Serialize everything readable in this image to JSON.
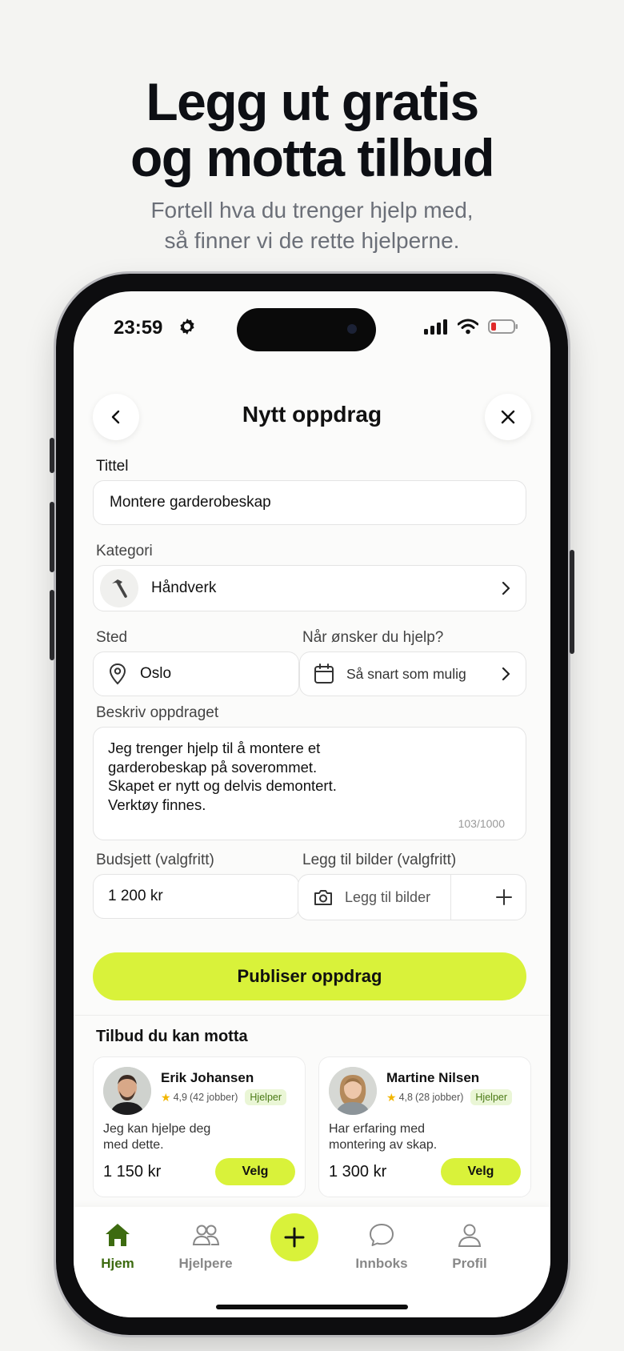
{
  "hero": {
    "title": "Legg ut gratis\nog motta tilbud",
    "subtitle": "Fortell hva du trenger hjelp med,\nså finner vi de rette hjelperne."
  },
  "status_bar": {
    "time": "23:59"
  },
  "header": {
    "title": "Nytt oppdrag",
    "back_icon": "chevron-left-icon",
    "close_icon": "close-icon"
  },
  "form": {
    "title_label": "Tittel",
    "title_value": "Montere garderobeskap",
    "category_label": "Kategori",
    "category_value": "Håndverk",
    "category_icon": "hammer-icon",
    "place_label": "Sted",
    "place_value": "Oslo",
    "when_label": "Når ønsker du hjelp?",
    "when_value": "Så snart som mulig",
    "description_label": "Beskriv oppdraget",
    "description_value": "Jeg trenger hjelp til å montere et\ngarderobeskap på soverommet.\nSkapet er nytt og delvis demontert.\nVerktøy finnes.",
    "description_counter": "103/1000",
    "budget_label": "Budsjett (valgfritt)",
    "budget_value": "1 200 kr",
    "images_label": "Legg til bilder (valgfritt)",
    "images_button": "Legg til bilder",
    "publish_button": "Publiser oppdrag"
  },
  "offers": {
    "section_title": "Tilbud du kan motta",
    "items": [
      {
        "name": "Erik Johansen",
        "rating": "4,9",
        "jobs": "(42 jobber)",
        "badge": "Hjelper",
        "message": "Jeg kan hjelpe deg\nmed dette.",
        "price": "1 150 kr",
        "button": "Velg"
      },
      {
        "name": "Martine Nilsen",
        "rating": "4,8",
        "jobs": "(28 jobber)",
        "badge": "Hjelper",
        "message": "Har erfaring med\nmontering av skap.",
        "price": "1 300 kr",
        "button": "Velg"
      }
    ]
  },
  "tabbar": {
    "items": [
      {
        "label": "Hjem",
        "icon": "home-icon",
        "active": true
      },
      {
        "label": "Hjelpere",
        "icon": "users-icon",
        "active": false
      },
      {
        "label": "",
        "icon": "plus-icon",
        "active": false
      },
      {
        "label": "Innboks",
        "icon": "chat-icon",
        "active": false
      },
      {
        "label": "Profil",
        "icon": "profile-icon",
        "active": false
      }
    ]
  },
  "colors": {
    "accent": "#d9f23a",
    "active_tab": "#3d6b10",
    "badge_bg": "#eaf6d6"
  }
}
